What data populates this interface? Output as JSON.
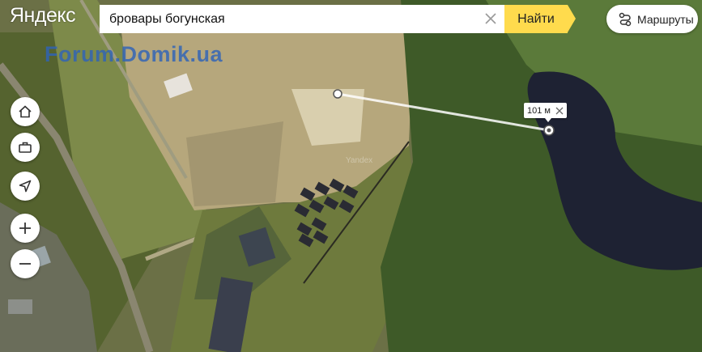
{
  "header": {
    "logo": "Яндекс",
    "search_value": "бровары богунская",
    "find_label": "Найти",
    "routes_label": "Маршруты"
  },
  "watermark": "Forum.Domik.ua",
  "map_watermark": "Yandex",
  "ruler": {
    "distance_label": "101 м"
  },
  "controls": [
    {
      "name": "home-button",
      "icon": "home-icon"
    },
    {
      "name": "briefcase-button",
      "icon": "briefcase-icon"
    },
    {
      "name": "locate-button",
      "icon": "navigation-arrow-icon"
    },
    {
      "name": "zoom-in-button",
      "icon": "plus-icon"
    },
    {
      "name": "zoom-out-button",
      "icon": "minus-icon"
    }
  ],
  "colors": {
    "accent": "#ffdb4d",
    "water": "#1e2233",
    "forest": "#3d5a2a"
  }
}
